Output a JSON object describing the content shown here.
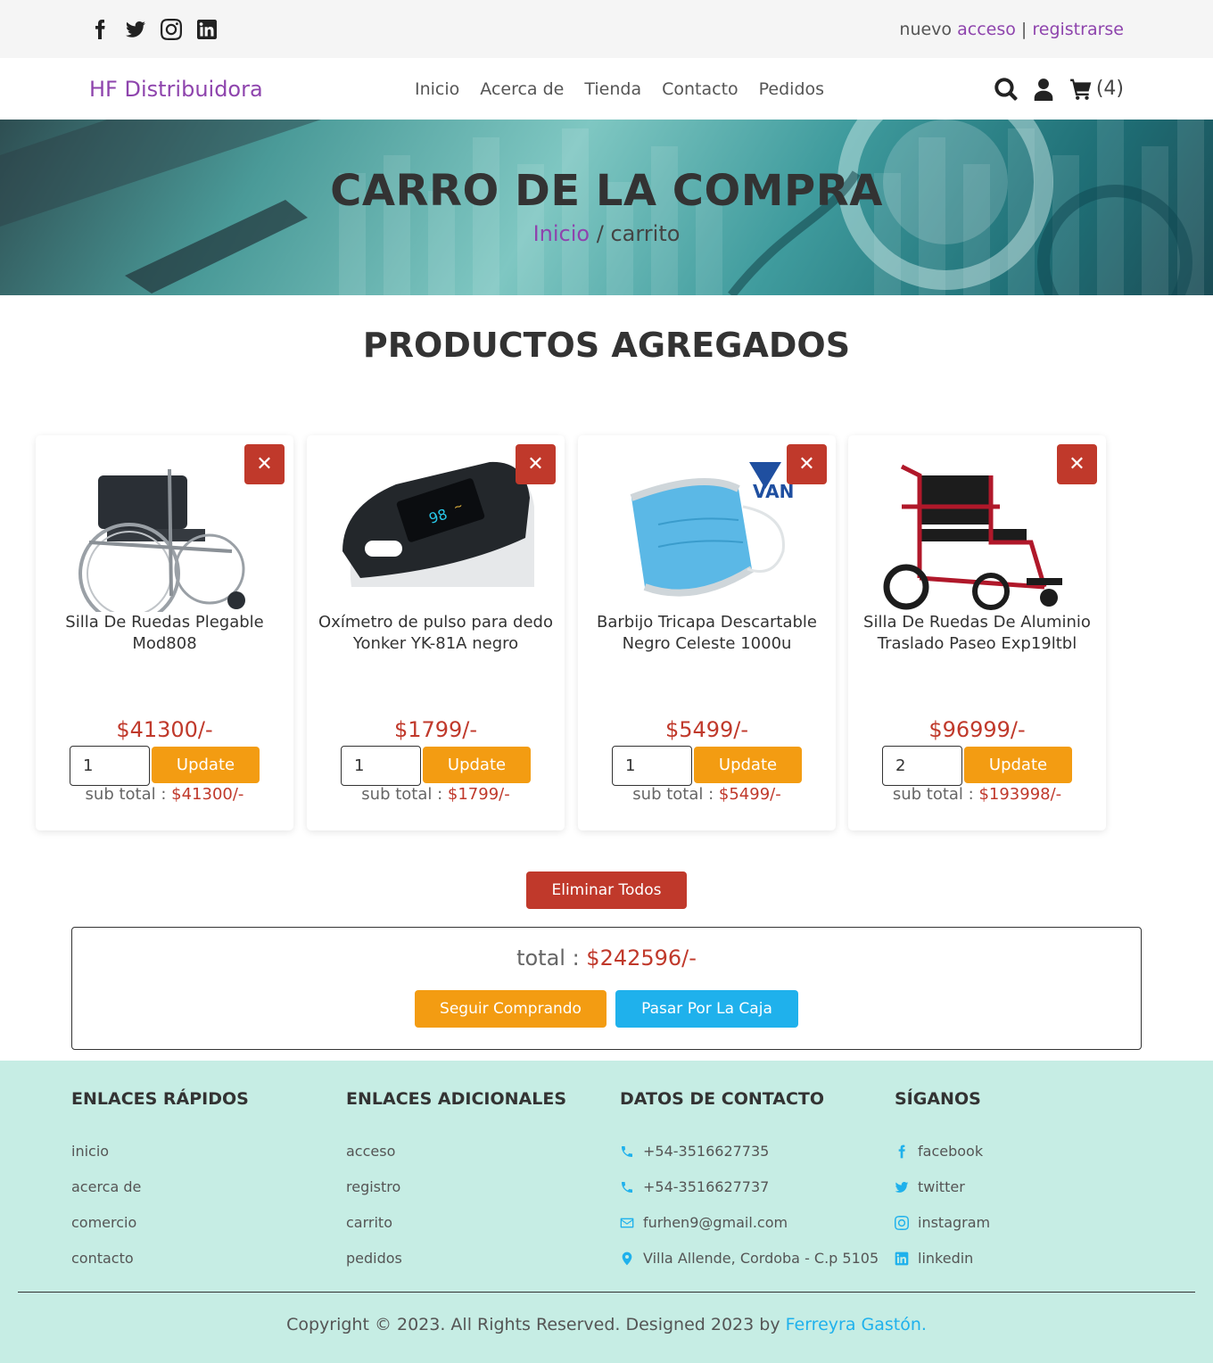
{
  "topbar": {
    "social_icons": [
      "facebook-icon",
      "twitter-icon",
      "instagram-icon",
      "linkedin-icon"
    ],
    "auth_prefix": "nuevo",
    "login_label": "acceso",
    "separator": "|",
    "register_label": "registrarse"
  },
  "header": {
    "logo": "HF Distribuidora",
    "nav": [
      "Inicio",
      "Acerca de",
      "Tienda",
      "Contacto",
      "Pedidos"
    ],
    "cart_count": "(4)"
  },
  "banner": {
    "title": "CARRO DE LA COMPRA",
    "crumb_link": "Inicio",
    "crumb_current": " / carrito"
  },
  "section_title": "PRODUCTOS AGREGADOS",
  "products": [
    {
      "name": "Silla De Ruedas Plegable Mod808",
      "price": "$41300/-",
      "qty": "1",
      "subtotal": "$41300/-",
      "image": "wheelchair-image"
    },
    {
      "name": "Oxímetro de pulso para dedo Yonker YK-81A negro",
      "price": "$1799/-",
      "qty": "1",
      "subtotal": "$1799/-",
      "image": "oximeter-image"
    },
    {
      "name": "Barbijo Tricapa Descartable Negro Celeste 1000u",
      "price": "$5499/-",
      "qty": "1",
      "subtotal": "$5499/-",
      "image": "face-mask-image"
    },
    {
      "name": "Silla De Ruedas De Aluminio Traslado Paseo Exp19ltbl",
      "price": "$96999/-",
      "qty": "2",
      "subtotal": "$193998/-",
      "image": "red-wheelchair-image"
    }
  ],
  "labels": {
    "update": "Update",
    "subtotal_prefix": "sub total : ",
    "delete_all": "Eliminar Todos",
    "total_prefix": "total : ",
    "continue_shopping": "Seguir Comprando",
    "checkout": "Pasar Por La Caja"
  },
  "total": "$242596/-",
  "footer": {
    "quick_links": {
      "title": "ENLACES RÁPIDOS",
      "items": [
        "inicio",
        "acerca de",
        "comercio",
        "contacto"
      ]
    },
    "extra_links": {
      "title": "ENLACES ADICIONALES",
      "items": [
        "acceso",
        "registro",
        "carrito",
        "pedidos"
      ]
    },
    "contact": {
      "title": "DATOS DE CONTACTO",
      "items": [
        "+54-3516627735",
        "+54-3516627737",
        "furhen9@gmail.com",
        "Villa Allende, Cordoba - C.p 5105"
      ]
    },
    "follow": {
      "title": "SÍGANOS",
      "items": [
        "facebook",
        "twitter",
        "instagram",
        "linkedin"
      ]
    },
    "copyright_text": "Copyright © 2023. All Rights Reserved. Designed 2023 by ",
    "author": "Ferreyra Gastón."
  },
  "colors": {
    "accent": "#8e44ad",
    "danger": "#c0392b",
    "orange": "#f39c12",
    "blue": "#1fb1ec",
    "footer_bg": "#c6ede4"
  }
}
